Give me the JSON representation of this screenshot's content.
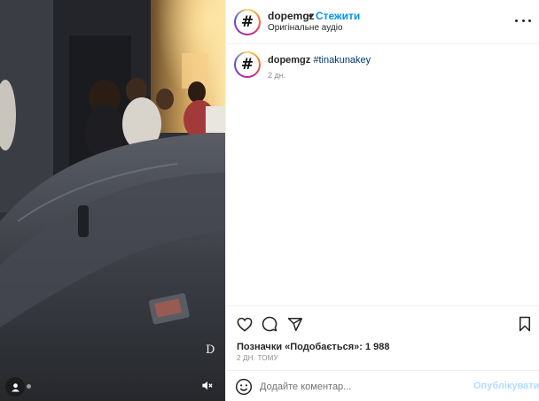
{
  "post": {
    "username": "dopemgz",
    "bullet": "•",
    "follow_label": "Стежити",
    "audio_label": "Оригінальне аудіо",
    "avatar_glyph": "#"
  },
  "caption": {
    "username": "dopemgz",
    "hashtag": "#tinakunakey",
    "time": "2 дн."
  },
  "actions": {
    "icons": [
      "heart-icon",
      "comment-icon",
      "share-icon",
      "bookmark-icon"
    ]
  },
  "likes_text": "Позначки «Подобається»: 1 988",
  "posted_ago": "2 ДН. ТОМУ",
  "comment": {
    "placeholder": "Додайте коментар...",
    "publish_label": "Опублікувати",
    "emoji_icon": "emoji-icon"
  },
  "media": {
    "watermark": "D",
    "icons": [
      "user-tag-icon",
      "mute-icon"
    ]
  },
  "colors": {
    "accent": "#0095f6",
    "hashtag": "#00376b",
    "muted": "#8e8e8e",
    "publish_disabled": "#b3dbff"
  }
}
